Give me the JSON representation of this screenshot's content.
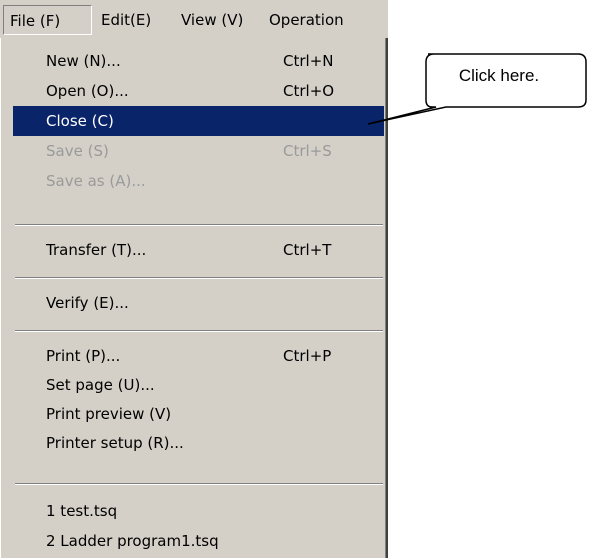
{
  "menubar": {
    "items": [
      {
        "label": "File (F)"
      },
      {
        "label": "Edit(E)"
      },
      {
        "label": "View (V)"
      },
      {
        "label": "Operation"
      }
    ]
  },
  "file_menu": {
    "items": [
      {
        "label": "New (N)...",
        "shortcut": "Ctrl+N",
        "state": "normal"
      },
      {
        "label": "Open (O)...",
        "shortcut": "Ctrl+O",
        "state": "normal"
      },
      {
        "label": "Close (C)",
        "shortcut": "",
        "state": "highlighted"
      },
      {
        "label": "Save (S)",
        "shortcut": "Ctrl+S",
        "state": "disabled"
      },
      {
        "label": "Save as (A)...",
        "shortcut": "",
        "state": "disabled"
      },
      {
        "label": "Transfer (T)...",
        "shortcut": "Ctrl+T",
        "state": "normal"
      },
      {
        "label": "Verify (E)...",
        "shortcut": "",
        "state": "normal"
      },
      {
        "label": "Print (P)...",
        "shortcut": "Ctrl+P",
        "state": "normal"
      },
      {
        "label": "Set page (U)...",
        "shortcut": "",
        "state": "normal"
      },
      {
        "label": "Print preview (V)",
        "shortcut": "",
        "state": "normal"
      },
      {
        "label": "Printer setup (R)...",
        "shortcut": "",
        "state": "normal"
      },
      {
        "label": "1 test.tsq",
        "shortcut": "",
        "state": "normal"
      },
      {
        "label": "2 Ladder program1.tsq",
        "shortcut": "",
        "state": "normal"
      }
    ]
  },
  "callout": {
    "text": "Click here."
  },
  "colors": {
    "menu_bg": "#d4d0c8",
    "highlight_bg": "#0a246a",
    "highlight_text": "#ffffff",
    "disabled_text": "#9a9a9a"
  }
}
